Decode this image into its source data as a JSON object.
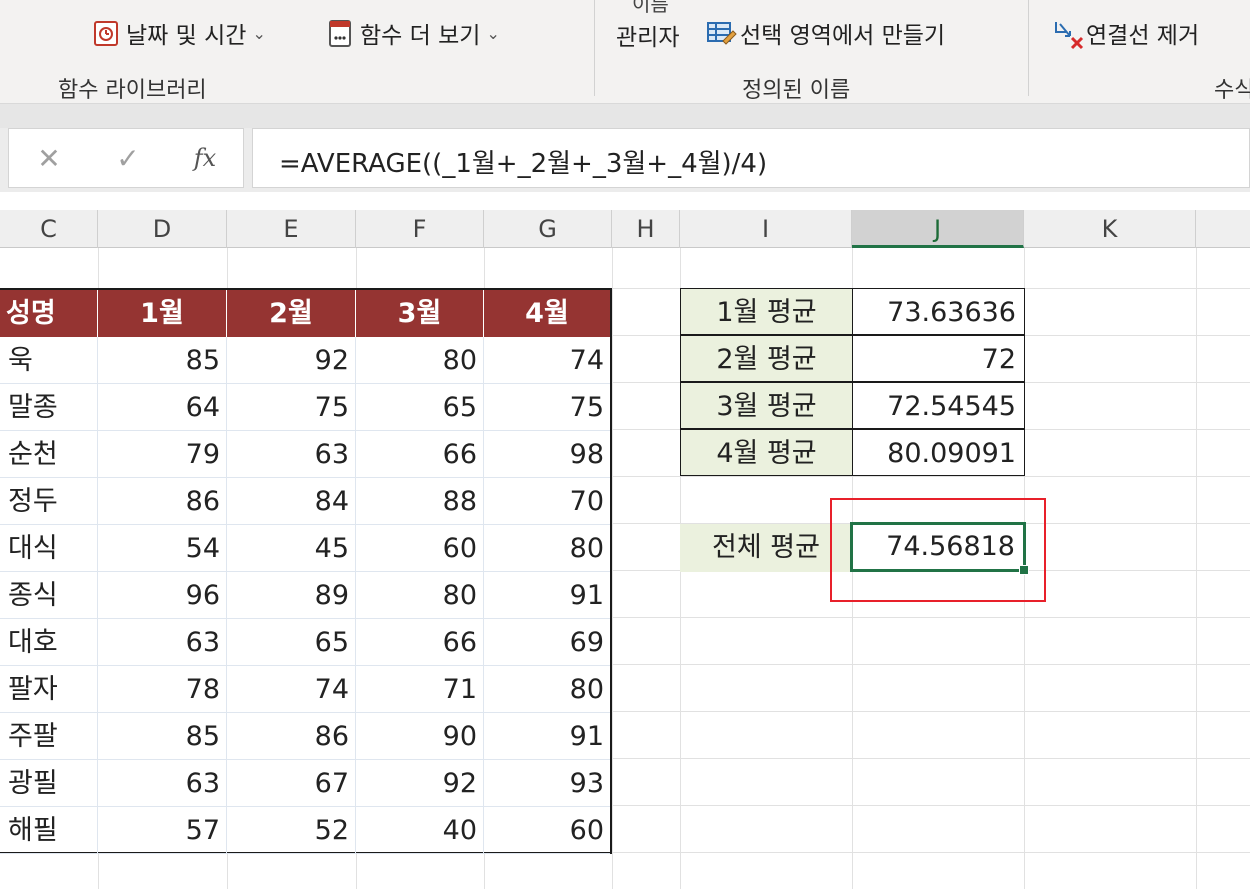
{
  "ribbon": {
    "date_time": "날짜 및 시간",
    "more_functions": "함수 더 보기",
    "function_library": "함수 라이브러리",
    "name_top": "이름",
    "name_manager": "관리자",
    "create_from_selection": "선택 영역에서 만들기",
    "defined_names": "정의된 이름",
    "remove_arrows": "연결선 제거",
    "formula_auditing_partial": "수식"
  },
  "formula_bar": {
    "cancel_glyph": "✕",
    "enter_glyph": "✓",
    "fx_glyph": "fx",
    "formula": "=AVERAGE((_1월+_2월+_3월+_4월)/4)"
  },
  "columns": [
    "C",
    "D",
    "E",
    "F",
    "G",
    "H",
    "I",
    "J",
    "K"
  ],
  "selected_column": "J",
  "table": {
    "headers": [
      "성명",
      "1월",
      "2월",
      "3월",
      "4월"
    ],
    "rows": [
      [
        "욱",
        "85",
        "92",
        "80",
        "74"
      ],
      [
        "말종",
        "64",
        "75",
        "65",
        "75"
      ],
      [
        "순천",
        "79",
        "63",
        "66",
        "98"
      ],
      [
        "정두",
        "86",
        "84",
        "88",
        "70"
      ],
      [
        "대식",
        "54",
        "45",
        "60",
        "80"
      ],
      [
        "종식",
        "96",
        "89",
        "80",
        "91"
      ],
      [
        "대호",
        "63",
        "65",
        "66",
        "69"
      ],
      [
        "팔자",
        "78",
        "74",
        "71",
        "80"
      ],
      [
        "주팔",
        "85",
        "86",
        "90",
        "91"
      ],
      [
        "광필",
        "63",
        "67",
        "92",
        "93"
      ],
      [
        "해필",
        "57",
        "52",
        "40",
        "60"
      ]
    ]
  },
  "averages": [
    {
      "label": "1월 평균",
      "value": "73.63636"
    },
    {
      "label": "2월 평균",
      "value": "72"
    },
    {
      "label": "3월 평균",
      "value": "72.54545"
    },
    {
      "label": "4월 평균",
      "value": "80.09091"
    }
  ],
  "total_average": {
    "label": "전체 평균",
    "value": "74.56818"
  },
  "colors": {
    "header_fill": "#953432",
    "label_fill": "#ebf1de",
    "selection": "#217346",
    "highlight_box": "#e8202a"
  }
}
